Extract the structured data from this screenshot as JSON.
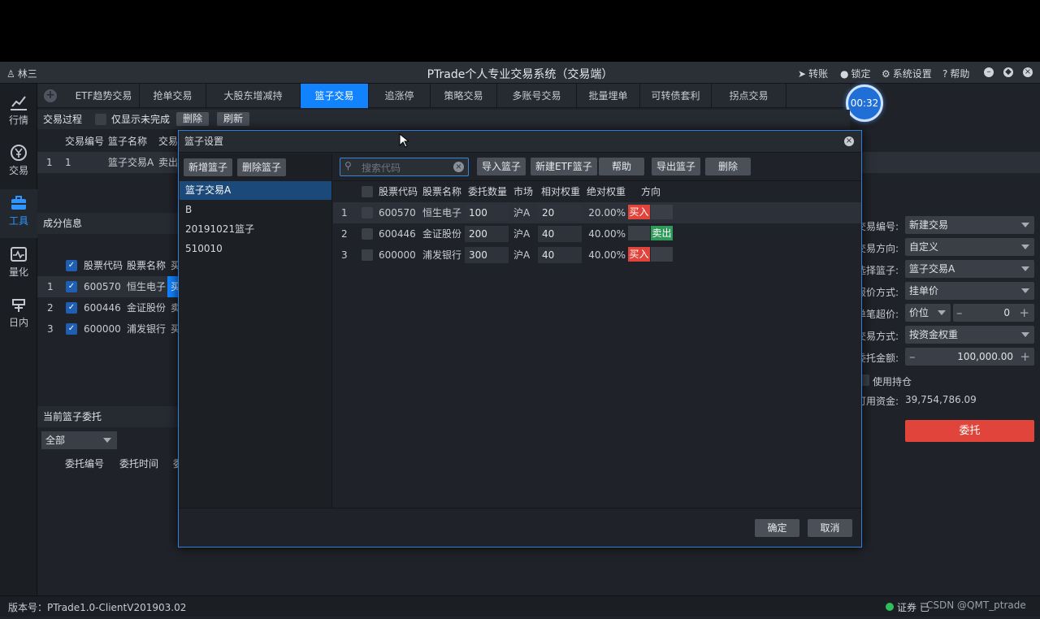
{
  "app": {
    "title": "PTrade个人专业交易系统（交易端）",
    "user": "林三",
    "top_actions": [
      "转账",
      "锁定",
      "系统设置",
      "帮助"
    ],
    "timer": "00:32",
    "version": "版本号：PTrade1.0-ClientV201903.02",
    "status_right": "证券 已",
    "watermark": "CSDN @QMT_ptrade"
  },
  "sidebar": [
    {
      "label": "行情",
      "icon": "chart-line-icon"
    },
    {
      "label": "交易",
      "icon": "yen-circle-icon"
    },
    {
      "label": "工具",
      "icon": "briefcase-icon",
      "active": true
    },
    {
      "label": "量化",
      "icon": "pulse-chart-icon"
    },
    {
      "label": "日内",
      "icon": "intraday-icon"
    }
  ],
  "tabs": [
    "ETF趋势交易",
    "抢单交易",
    "大股东增减持",
    "篮子交易",
    "追涨停",
    "策略交易",
    "多账号交易",
    "批量埋单",
    "可转债套利",
    "拐点交易"
  ],
  "active_tab": "篮子交易",
  "process": {
    "title": "交易过程",
    "only_unfinished": "仅显示未完成",
    "delete": "删除",
    "refresh": "刷新",
    "headers": [
      "交易编号",
      "篮子名称",
      "交易"
    ],
    "rows": [
      {
        "idx": "1",
        "no": "1",
        "name": "篮子交易A",
        "trade": "卖出"
      }
    ]
  },
  "components": {
    "title": "成分信息",
    "headers": [
      "股票代码",
      "股票名称",
      "买"
    ],
    "rows": [
      {
        "idx": "1",
        "code": "600570",
        "name": "恒生电子",
        "dir": "买"
      },
      {
        "idx": "2",
        "code": "600446",
        "name": "金证股份",
        "dir": "卖"
      },
      {
        "idx": "3",
        "code": "600000",
        "name": "浦发银行",
        "dir": "买"
      }
    ]
  },
  "current_orders": {
    "title": "当前篮子委托",
    "filter": "全部",
    "headers": [
      "委托编号",
      "委托时间",
      "委"
    ]
  },
  "form": {
    "fields": [
      {
        "label": "交易编号:",
        "value": "新建交易",
        "type": "select"
      },
      {
        "label": "交易方向:",
        "value": "自定义",
        "type": "select"
      },
      {
        "label": "选择篮子:",
        "value": "篮子交易A",
        "type": "select"
      },
      {
        "label": "报价方式:",
        "value": "挂单价",
        "type": "select"
      },
      {
        "label": "单笔超价:",
        "value": "价位",
        "value2": "0",
        "type": "stepper"
      },
      {
        "label": "交易方式:",
        "value": "按资金权重",
        "type": "select"
      },
      {
        "label": "委托金额:",
        "value": "100,000.00",
        "type": "amount"
      }
    ],
    "use_position": "使用持仓",
    "available_label": "可用资金:",
    "available_value": "39,754,786.09",
    "submit": "委托"
  },
  "modal": {
    "title": "篮子设置",
    "new_basket": "新增篮子",
    "delete_basket": "删除篮子",
    "baskets": [
      "篮子交易A",
      "B",
      "20191021篮子",
      "510010"
    ],
    "search_placeholder": "搜索代码",
    "buttons": [
      "导入篮子",
      "新建ETF篮子",
      "帮助",
      "导出篮子",
      "删除"
    ],
    "headers": [
      "股票代码",
      "股票名称",
      "委托数量",
      "市场",
      "相对权重",
      "绝对权重",
      "方向"
    ],
    "rows": [
      {
        "idx": "1",
        "code": "600570",
        "name": "恒生电子",
        "qty": "100",
        "market": "沪A",
        "rel": "20",
        "abs": "20.00%",
        "dir": "买入",
        "dir_type": "buy"
      },
      {
        "idx": "2",
        "code": "600446",
        "name": "金证股份",
        "qty": "200",
        "market": "沪A",
        "rel": "40",
        "abs": "40.00%",
        "dir": "卖出",
        "dir_type": "sell"
      },
      {
        "idx": "3",
        "code": "600000",
        "name": "浦发银行",
        "qty": "300",
        "market": "沪A",
        "rel": "40",
        "abs": "40.00%",
        "dir": "买入",
        "dir_type": "buy"
      }
    ],
    "ok": "确定",
    "cancel": "取消"
  },
  "colors": {
    "accent": "#1183ff",
    "buy": "#e0443b",
    "sell": "#2f9a59",
    "modal_border": "#2f7fd9"
  }
}
